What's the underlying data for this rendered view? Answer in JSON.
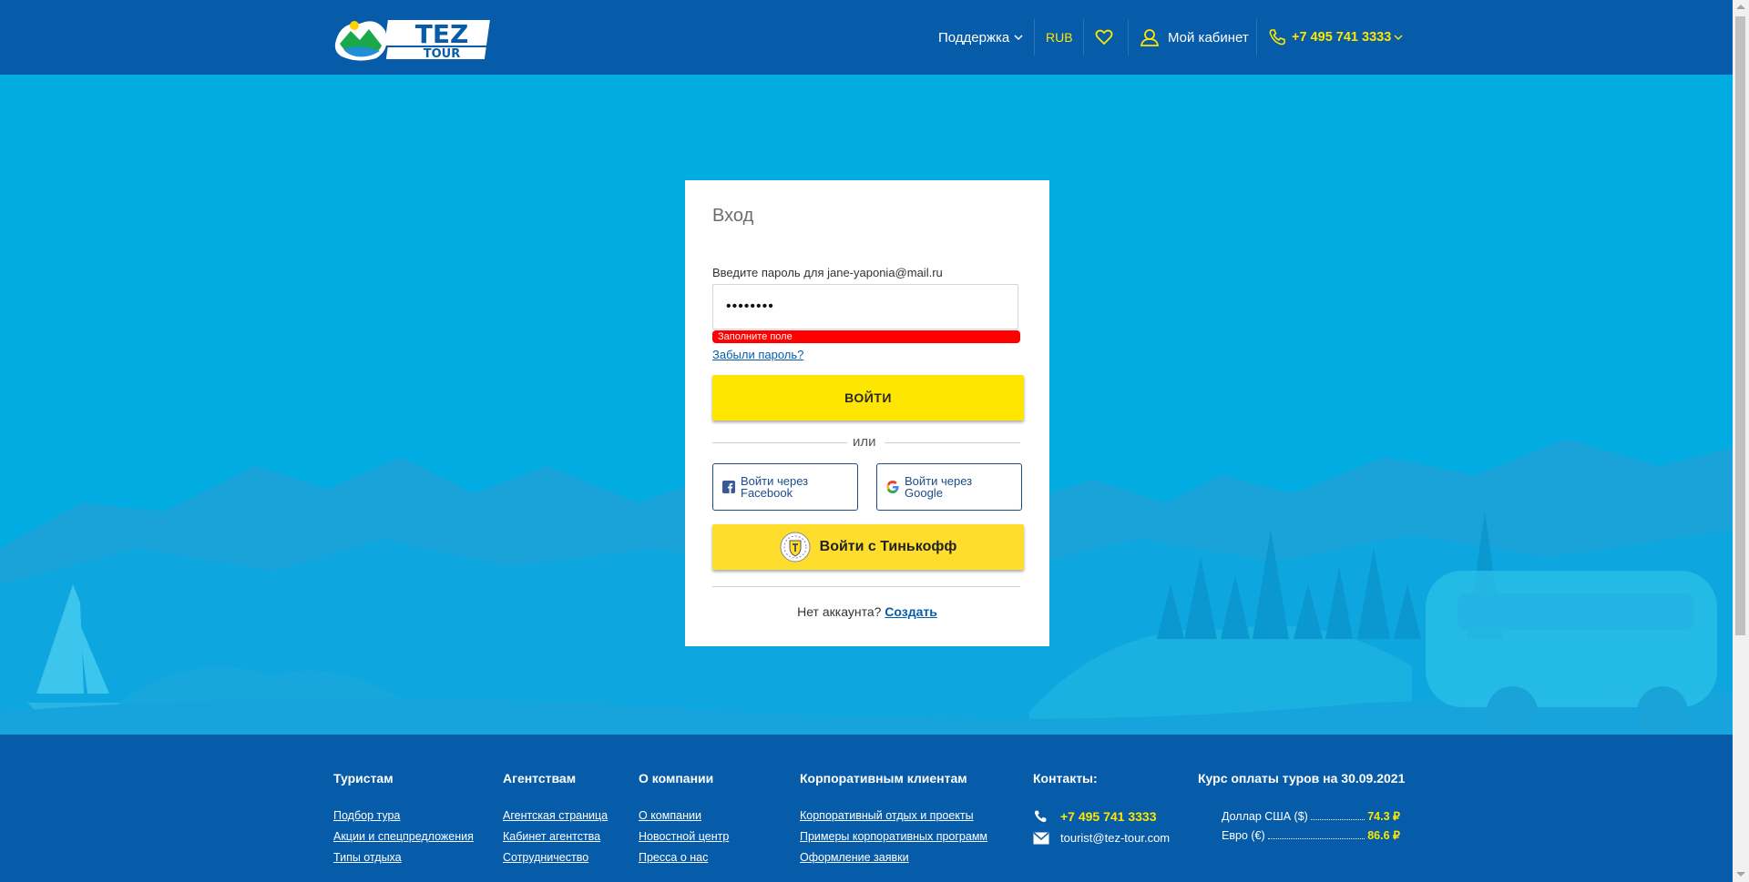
{
  "header": {
    "logo_top": "TEZ",
    "logo_bottom": "TOUR",
    "support_label": "Поддержка",
    "currency_label": "RUB",
    "cabinet_label": "Мой кабинет",
    "phone_label": "+7 495 741 3333",
    "brand_color": "#075ca9",
    "accent_color": "#ffe600"
  },
  "login": {
    "title": "Вход",
    "password_prompt": "Введите пароль для jane-yaponia@mail.ru",
    "password_value": "••••••••",
    "error_message": "Заполните поле",
    "forgot_link": "Забыли пароль?",
    "submit_label": "ВОЙТИ",
    "or_label": "или",
    "facebook_label": "Войти через Facebook",
    "google_label": "Войти через Google",
    "tinkoff_label": "Войти с Тинькофф",
    "no_account_text": "Нет аккаунта?",
    "create_link": "Создать"
  },
  "footer": {
    "tourists": {
      "title": "Туристам",
      "links": [
        "Подбор тура",
        "Акции и спецпредложения",
        "Типы отдыха"
      ]
    },
    "agencies": {
      "title": "Агентствам",
      "links": [
        "Агентская страница",
        "Кабинет агентства",
        "Сотрудничество"
      ]
    },
    "company": {
      "title": "О компании",
      "links": [
        "О компании",
        "Новостной центр",
        "Пресса о нас"
      ]
    },
    "corporate": {
      "title": "Корпоративным клиентам",
      "links": [
        "Корпоративный отдых и проекты",
        "Примеры корпоративных программ",
        "Оформление заявки"
      ]
    },
    "contacts": {
      "title": "Контакты:",
      "phone": "+7 495 741 3333",
      "email": "tourist@tez-tour.com"
    },
    "rates": {
      "title": "Курс оплаты туров на 30.09.2021",
      "items": [
        {
          "label": "Доллар США ($)",
          "value": "74.3 ₽"
        },
        {
          "label": "Евро (€)",
          "value": "86.6 ₽"
        }
      ]
    }
  }
}
